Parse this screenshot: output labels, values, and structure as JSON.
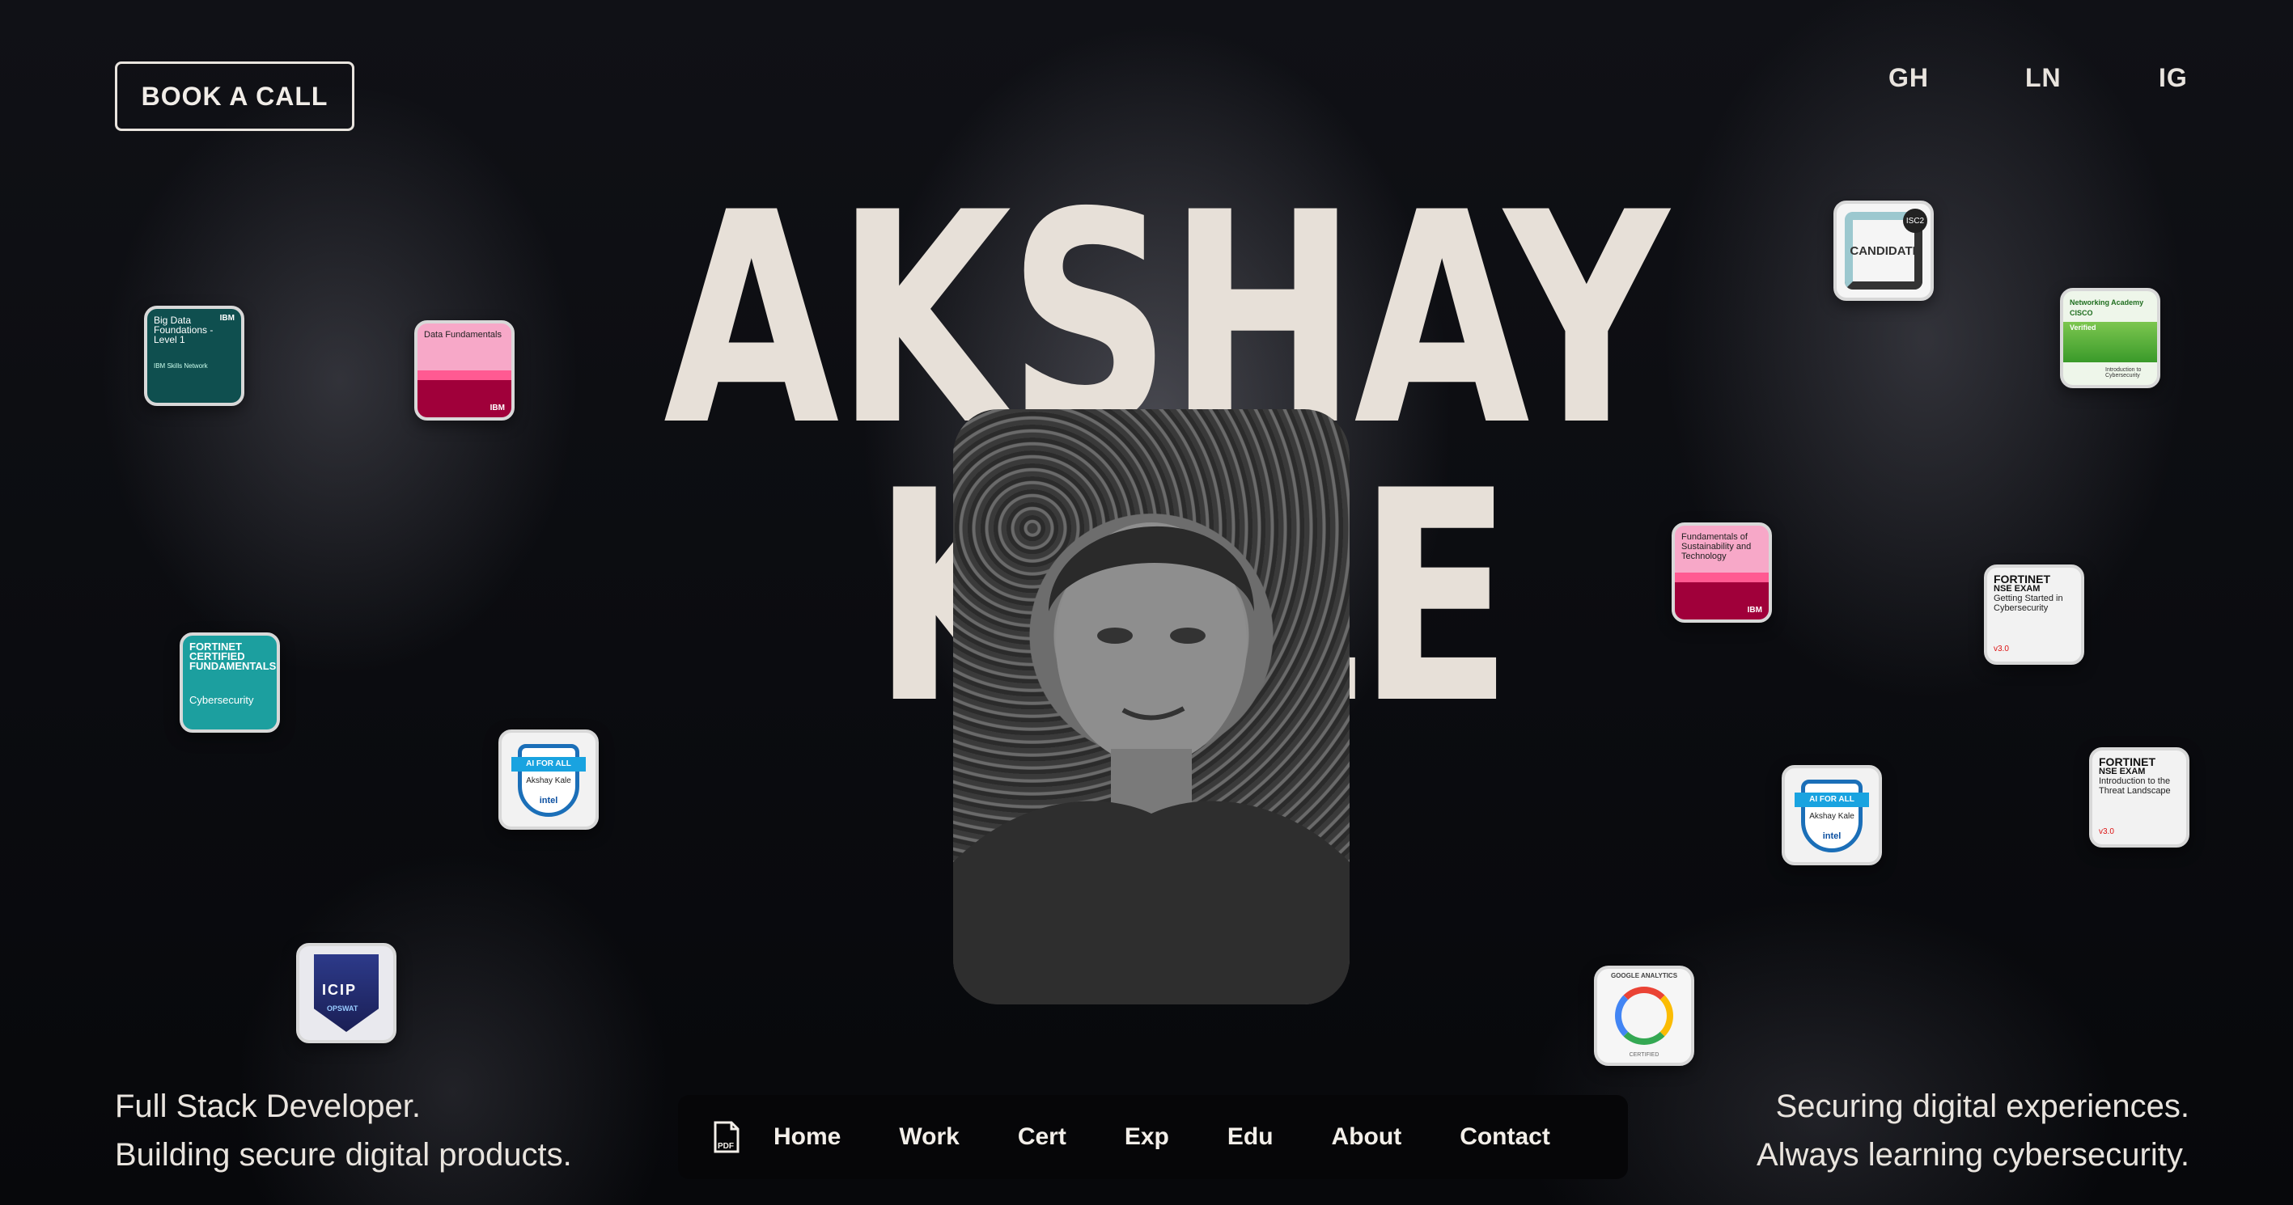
{
  "header": {
    "book_call": "BOOK A CALL",
    "socials": [
      "GH",
      "LN",
      "IG"
    ]
  },
  "hero": {
    "first_name": "AKSHAY",
    "last_name": "KALE"
  },
  "badges": {
    "big_data": {
      "title": "Big Data Foundations - Level 1",
      "org": "IBM",
      "sub": "IBM Skills Network"
    },
    "data_fund": {
      "title": "Data Fundamentals",
      "org": "IBM"
    },
    "fortinet_cert": {
      "title": "FORTINET CERTIFIED FUNDAMENTALS",
      "sub": "Cybersecurity"
    },
    "ai_for_all_left": {
      "ribbon": "AI FOR ALL",
      "name": "Akshay Kale",
      "brand": "intel"
    },
    "icip": {
      "label": "ICIP",
      "org": "OPSWAT"
    },
    "candidate": {
      "label": "CANDIDATE",
      "org": "ISC2"
    },
    "cisco": {
      "title": "Networking Academy",
      "org": "CISCO",
      "status": "Verified",
      "sub": "Introduction to Cybersecurity"
    },
    "sustainability": {
      "title": "Fundamentals of Sustainability and Technology",
      "org": "IBM"
    },
    "nse_getting_started": {
      "brand": "FORTINET",
      "exam": "NSE EXAM",
      "title": "Getting Started in Cybersecurity",
      "version": "v3.0"
    },
    "ai_for_all_right": {
      "ribbon": "AI FOR ALL",
      "name": "Akshay Kale",
      "brand": "intel"
    },
    "nse_threat": {
      "brand": "FORTINET",
      "exam": "NSE EXAM",
      "title": "Introduction to the Threat Landscape",
      "version": "v3.0"
    },
    "google_analytics": {
      "label": "GOOGLE ANALYTICS",
      "sub": "CERTIFIED"
    }
  },
  "taglines": {
    "left_1": "Full Stack Developer.",
    "left_2": "Building secure digital products.",
    "right_1": "Securing digital experiences.",
    "right_2": "Always learning cybersecurity."
  },
  "nav": {
    "pdf_icon_label": "PDF",
    "items": [
      "Home",
      "Work",
      "Cert",
      "Exp",
      "Edu",
      "About",
      "Contact"
    ]
  },
  "colors": {
    "background": "#0b0c10",
    "hero_text": "#e7e0d8",
    "navbar_bg": "#060608"
  }
}
